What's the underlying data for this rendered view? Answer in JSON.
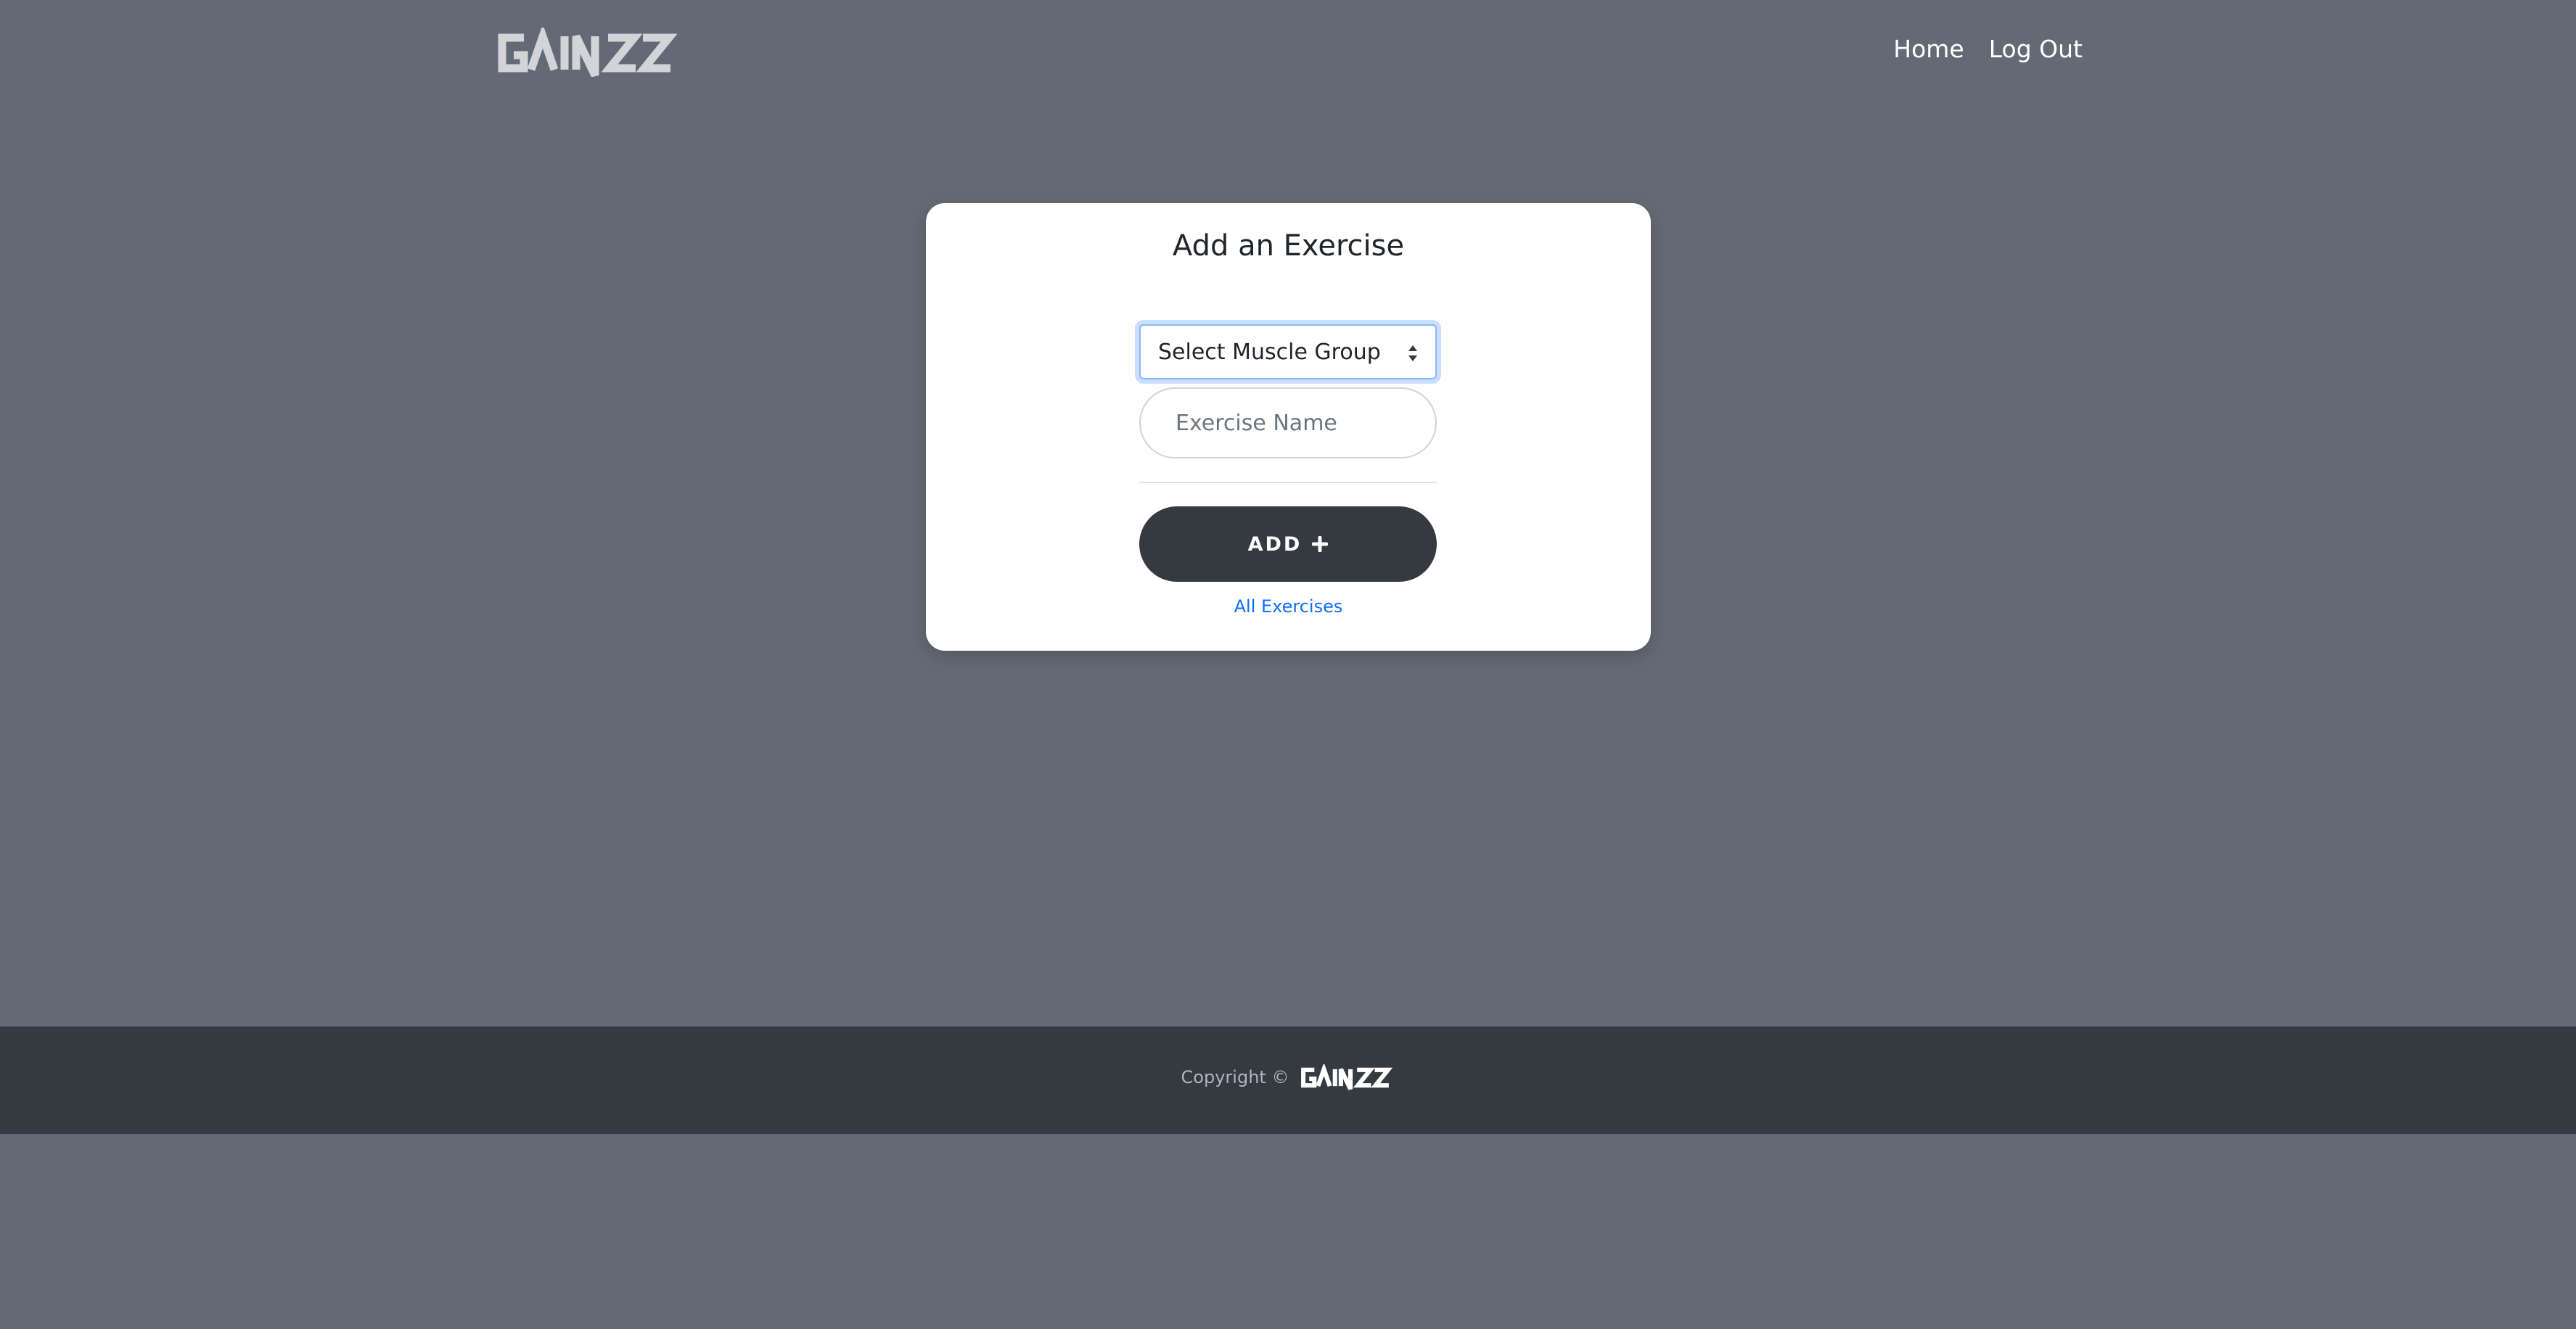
{
  "header": {
    "brand": "GAINZZ",
    "nav": [
      {
        "label": "Home"
      },
      {
        "label": "Log Out"
      }
    ]
  },
  "form": {
    "title": "Add an Exercise",
    "muscle_group_select": {
      "selected": "Select Muscle Group"
    },
    "exercise_name": {
      "placeholder": "Exercise Name",
      "value": ""
    },
    "add_button_label": "ADD",
    "all_exercises_link": "All Exercises"
  },
  "footer": {
    "copyright_text": "Copyright ©",
    "brand": "GAINZZ"
  },
  "colors": {
    "background": "#646a75",
    "card": "#ffffff",
    "dark": "#343a40",
    "link": "#0d6efd"
  },
  "icons": {
    "add_button": "plus-icon",
    "select": "sort-arrows-icon"
  }
}
